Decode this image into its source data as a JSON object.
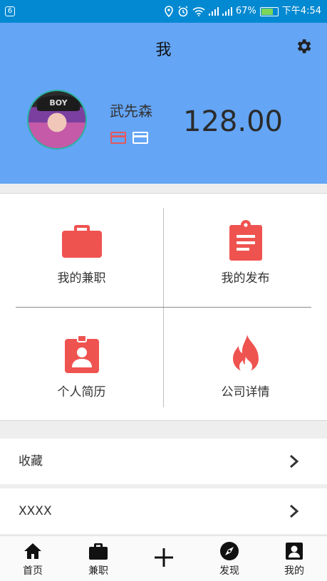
{
  "status_bar": {
    "notification": "6",
    "battery": "67%",
    "time": "下午4:54"
  },
  "header": {
    "title": "我",
    "username": "武先森",
    "balance": "128.00",
    "avatar_cap_text": "BOY"
  },
  "grid": [
    {
      "label": "我的兼职",
      "icon": "briefcase-icon"
    },
    {
      "label": "我的发布",
      "icon": "clipboard-icon"
    },
    {
      "label": "个人简历",
      "icon": "resume-icon"
    },
    {
      "label": "公司详情",
      "icon": "flame-icon"
    }
  ],
  "list": [
    {
      "label": "收藏"
    },
    {
      "label": "XXXX"
    }
  ],
  "nav": [
    {
      "label": "首页",
      "icon": "home-icon"
    },
    {
      "label": "兼职",
      "icon": "briefcase-icon"
    },
    {
      "label": "",
      "icon": "plus-icon"
    },
    {
      "label": "发现",
      "icon": "compass-icon"
    },
    {
      "label": "我的",
      "icon": "profile-icon"
    }
  ],
  "colors": {
    "status_bar": "#0289d1",
    "header": "#64a5f5",
    "accent_red": "#ef5350"
  }
}
